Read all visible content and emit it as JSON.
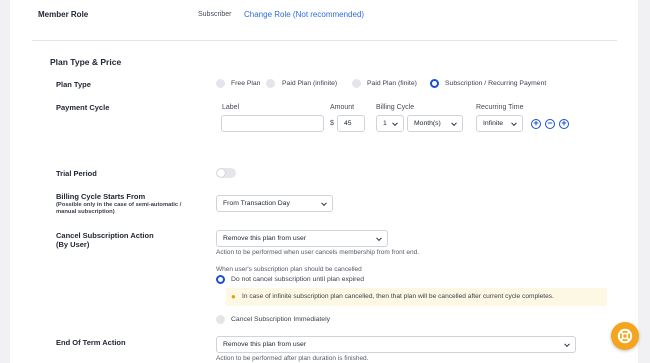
{
  "member_role": {
    "label": "Member Role",
    "value": "Subscriber",
    "change_link": "Change Role (Not recommended)"
  },
  "section": {
    "title": "Plan Type & Price"
  },
  "plan_type": {
    "label": "Plan Type",
    "options": [
      "Free Plan",
      "Paid Plan (infinite)",
      "Paid Plan (finite)",
      "Subscription / Recurring Payment"
    ],
    "selected": "Subscription / Recurring Payment"
  },
  "payment_cycle": {
    "label": "Payment Cycle",
    "headers": {
      "label": "Label",
      "amount": "Amount",
      "billing_cycle": "Billing Cycle",
      "recurring_time": "Recurring Time"
    },
    "label_value": "",
    "currency": "$",
    "amount": "45",
    "cycle_count": "1",
    "cycle_unit": "Month(s)",
    "recurring_time": "Infinite",
    "buttons": {
      "add": "+",
      "remove": "−"
    }
  },
  "trial_period": {
    "label": "Trial Period",
    "enabled": false
  },
  "billing_start": {
    "label": "Billing Cycle Starts From",
    "note_line1": "(Possible only in the case of semi-automatic /",
    "note_line2": "manual subscription)",
    "value": "From Transaction Day"
  },
  "cancel_action": {
    "label_line1": "Cancel Subscription Action",
    "label_line2": "(By User)",
    "value": "Remove this plan from user",
    "help": "Action to be performed when user cancels membership from front end."
  },
  "cancel_when": {
    "label": "When user's subscription plan should be cancelled",
    "option1": "Do not cancel subscription until plan expired",
    "notice": "In case of infinite subscription plan cancelled, then that plan will be cancelled after current cycle completes.",
    "option2": "Cancel Subscription Immediately"
  },
  "end_term": {
    "label": "End Of Term Action",
    "value": "Remove this plan from user",
    "help": "Action to be performed after plan duration is finished."
  },
  "colors": {
    "accent": "#1a4fd0",
    "link": "#2d6cdf",
    "fab": "#f2a51d",
    "notice_bg": "#fdf8e3"
  }
}
